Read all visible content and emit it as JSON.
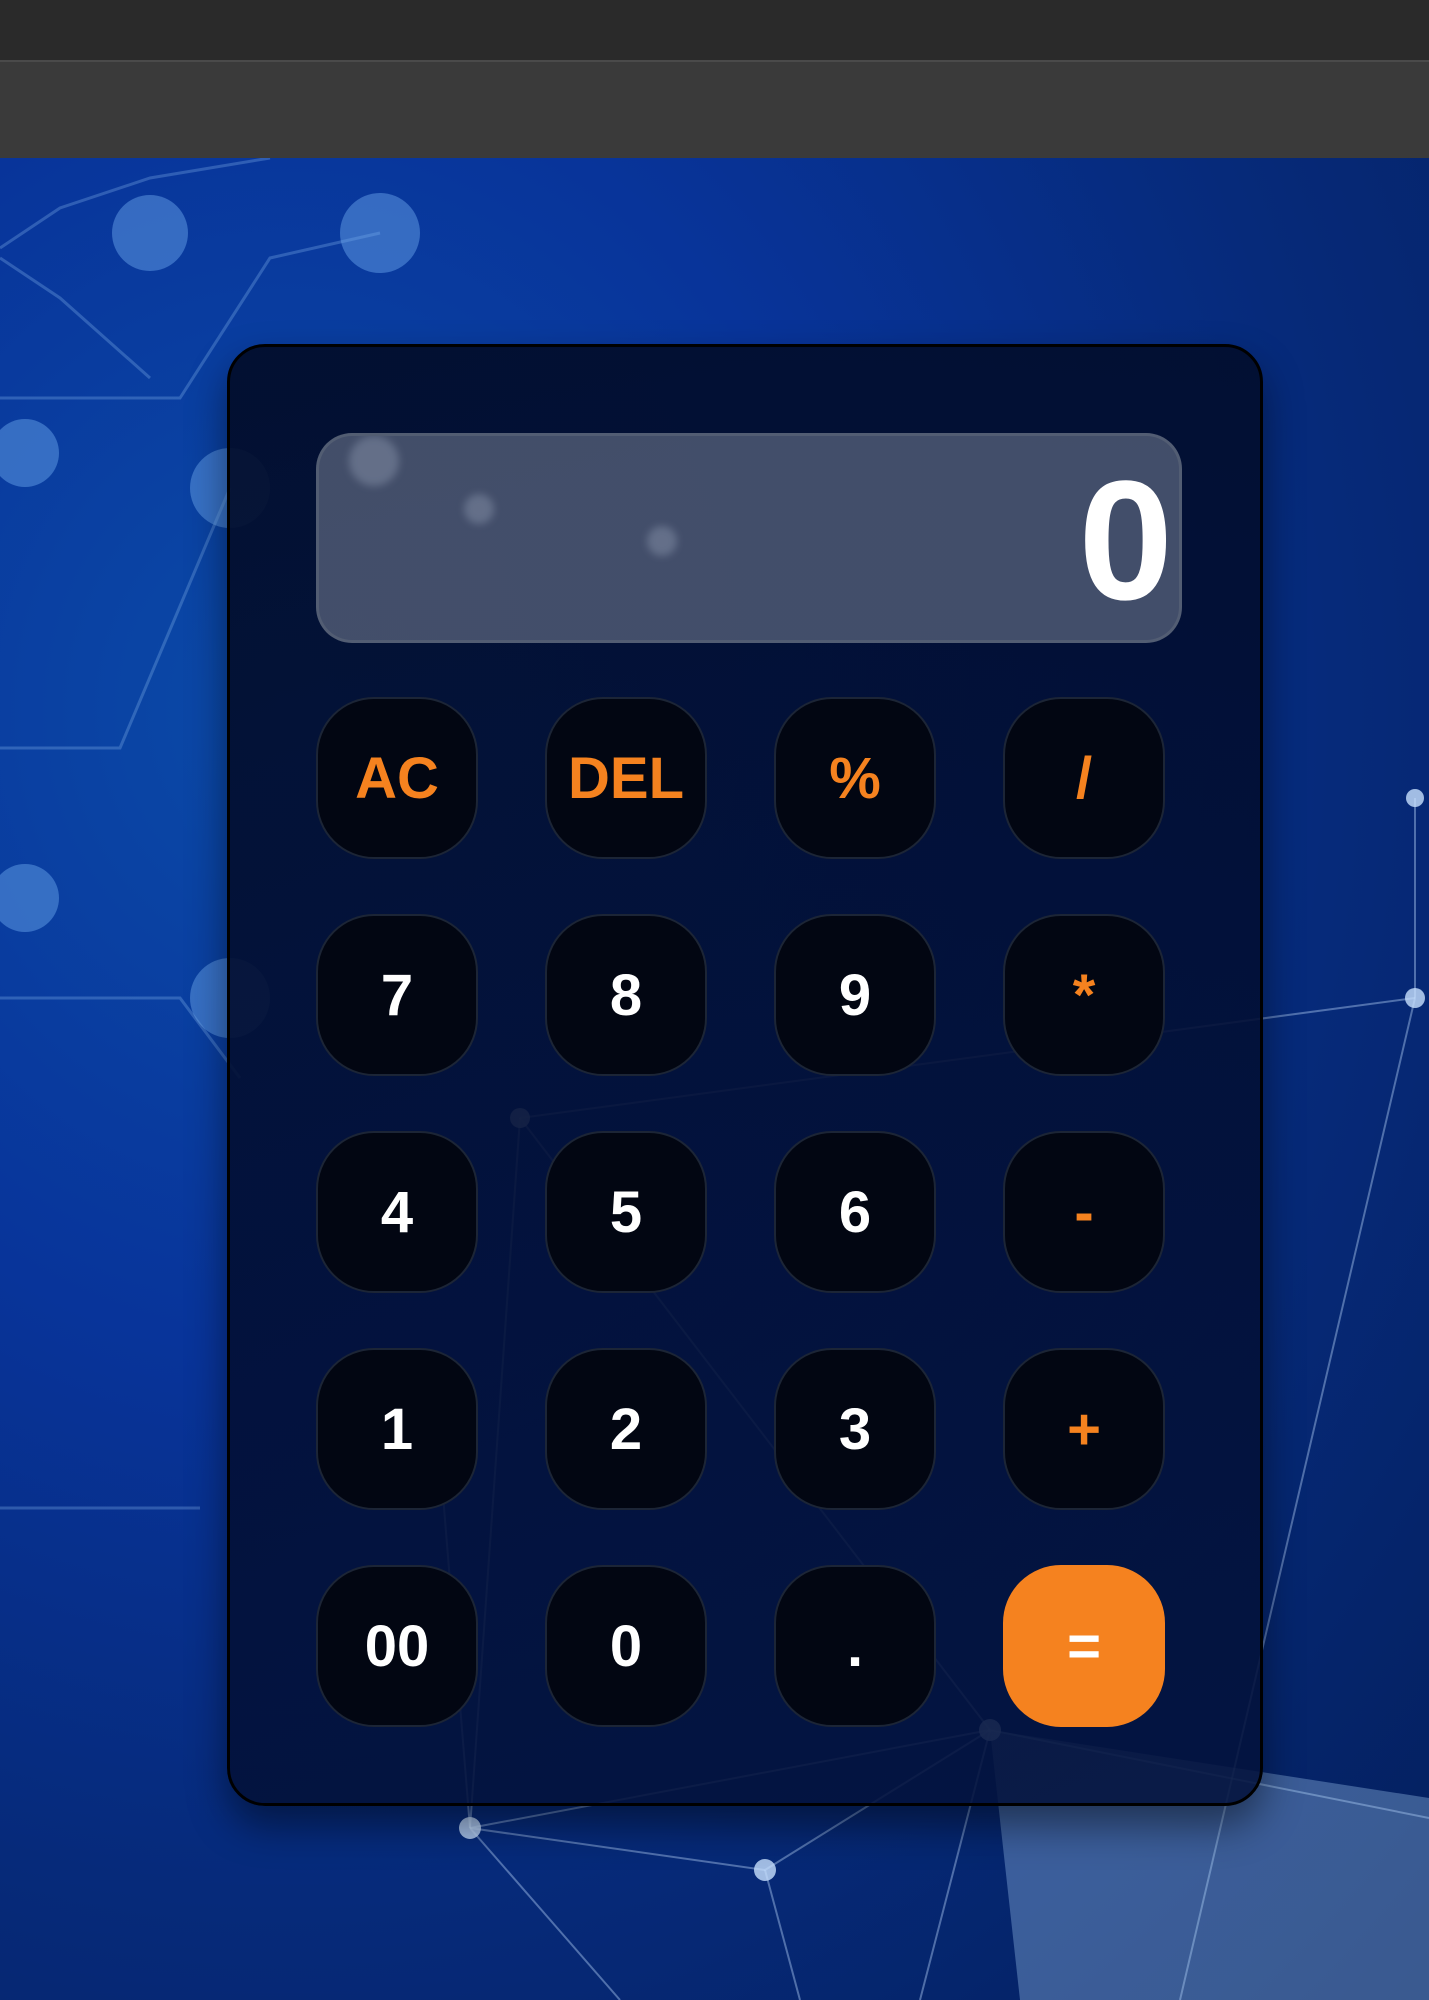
{
  "display": {
    "value": "0"
  },
  "keys": {
    "ac": "AC",
    "del": "DEL",
    "percent": "%",
    "divide": "/",
    "seven": "7",
    "eight": "8",
    "nine": "9",
    "multiply": "*",
    "four": "4",
    "five": "5",
    "six": "6",
    "subtract": "-",
    "one": "1",
    "two": "2",
    "three": "3",
    "add": "+",
    "double_zero": "00",
    "zero": "0",
    "decimal": ".",
    "equals": "="
  },
  "colors": {
    "accent": "#f5821f",
    "key_bg": "#020612",
    "digit_text": "#ffffff",
    "background": "#0a2a6e"
  }
}
